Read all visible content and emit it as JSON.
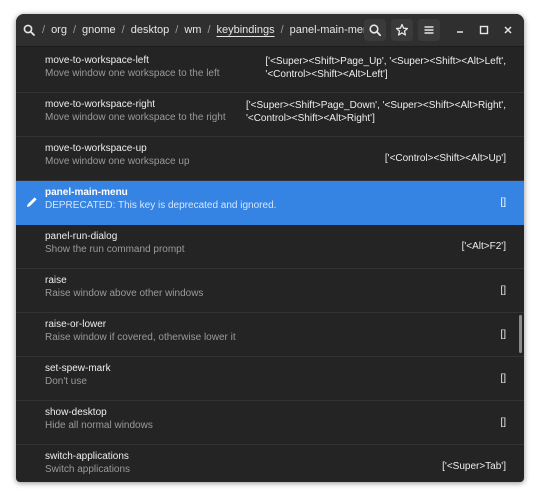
{
  "breadcrumb": {
    "items": [
      "/",
      "org",
      "/",
      "gnome",
      "/",
      "desktop",
      "/",
      "wm",
      "/",
      "keybindings",
      "/",
      "panel-main-menu"
    ]
  },
  "header": {
    "icons": [
      "search-icon",
      "star-icon",
      "menu-icon",
      "minimize-icon",
      "maximize-icon",
      "close-icon"
    ]
  },
  "rows": [
    {
      "name": "move-to-workspace-left",
      "desc": "Move window one workspace to the left",
      "value_lines": [
        "['<Super><Shift>Page_Up', '<Super><Shift><Alt>Left',",
        "'<Control><Shift><Alt>Left']"
      ],
      "selected": false
    },
    {
      "name": "move-to-workspace-right",
      "desc": "Move window one workspace to the right",
      "value_lines": [
        "['<Super><Shift>Page_Down', '<Super><Shift><Alt>Right',",
        "'<Control><Shift><Alt>Right']"
      ],
      "selected": false
    },
    {
      "name": "move-to-workspace-up",
      "desc": "Move window one workspace up",
      "value_lines": [
        "['<Control><Shift><Alt>Up']"
      ],
      "selected": false
    },
    {
      "name": "panel-main-menu",
      "desc": "DEPRECATED: This key is deprecated and ignored.",
      "value_lines": [
        "[]"
      ],
      "selected": true
    },
    {
      "name": "panel-run-dialog",
      "desc": "Show the run command prompt",
      "value_lines": [
        "['<Alt>F2']"
      ],
      "selected": false
    },
    {
      "name": "raise",
      "desc": "Raise window above other windows",
      "value_lines": [
        "[]"
      ],
      "selected": false
    },
    {
      "name": "raise-or-lower",
      "desc": "Raise window if covered, otherwise lower it",
      "value_lines": [
        "[]"
      ],
      "selected": false
    },
    {
      "name": "set-spew-mark",
      "desc": "Don't use",
      "value_lines": [
        "[]"
      ],
      "selected": false
    },
    {
      "name": "show-desktop",
      "desc": "Hide all normal windows",
      "value_lines": [
        "[]"
      ],
      "selected": false
    },
    {
      "name": "switch-applications",
      "desc": "Switch applications",
      "value_lines": [
        "['<Super>Tab']"
      ],
      "selected": false
    }
  ],
  "colors": {
    "accent": "#3584e4",
    "background": "#242424",
    "headerbar": "#2f2f2f",
    "text": "#eeeeee",
    "dim_text": "#9a9a9a"
  }
}
